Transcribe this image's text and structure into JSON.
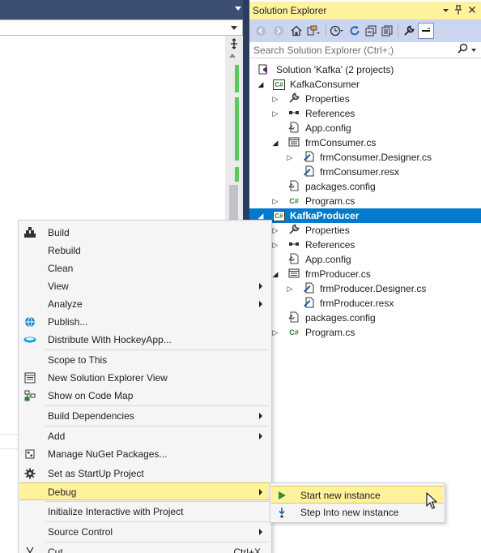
{
  "solution_explorer": {
    "title": "Solution Explorer",
    "search_placeholder": "Search Solution Explorer (Ctrl+;)",
    "toolbar_icons": [
      "back-icon",
      "forward-icon",
      "home-icon",
      "switch-views-icon",
      "history-icon",
      "refresh-icon",
      "collapse-all-icon",
      "show-all-files-icon",
      "properties-icon",
      "preview-icon"
    ],
    "tree": [
      {
        "label": "Solution 'Kafka' (2 projects)",
        "icon": "solution-icon",
        "level": 0,
        "expander": ""
      },
      {
        "label": "KafkaConsumer",
        "icon": "csharp-project-icon",
        "level": 1,
        "expander": "expanded"
      },
      {
        "label": "Properties",
        "icon": "wrench-icon",
        "level": 2,
        "expander": "collapsed"
      },
      {
        "label": "References",
        "icon": "references-icon",
        "level": 2,
        "expander": "collapsed"
      },
      {
        "label": "App.config",
        "icon": "config-file-icon",
        "level": 2,
        "expander": ""
      },
      {
        "label": "frmConsumer.cs",
        "icon": "form-icon",
        "level": 2,
        "expander": "expanded"
      },
      {
        "label": "frmConsumer.Designer.cs",
        "icon": "designer-file-icon",
        "level": 3,
        "expander": "collapsed"
      },
      {
        "label": "frmConsumer.resx",
        "icon": "resx-file-icon",
        "level": 3,
        "expander": ""
      },
      {
        "label": "packages.config",
        "icon": "config-file-icon",
        "level": 2,
        "expander": ""
      },
      {
        "label": "Program.cs",
        "icon": "csharp-file-icon",
        "level": 2,
        "expander": "collapsed"
      },
      {
        "label": "KafkaProducer",
        "icon": "csharp-project-icon",
        "level": 1,
        "expander": "expanded",
        "selected": true
      },
      {
        "label": "Properties",
        "icon": "wrench-icon",
        "level": 2,
        "expander": "collapsed"
      },
      {
        "label": "References",
        "icon": "references-icon",
        "level": 2,
        "expander": "collapsed"
      },
      {
        "label": "App.config",
        "icon": "config-file-icon",
        "level": 2,
        "expander": ""
      },
      {
        "label": "frmProducer.cs",
        "icon": "form-icon",
        "level": 2,
        "expander": "expanded"
      },
      {
        "label": "frmProducer.Designer.cs",
        "icon": "designer-file-icon",
        "level": 3,
        "expander": "collapsed"
      },
      {
        "label": "frmProducer.resx",
        "icon": "resx-file-icon",
        "level": 3,
        "expander": ""
      },
      {
        "label": "packages.config",
        "icon": "config-file-icon",
        "level": 2,
        "expander": ""
      },
      {
        "label": "Program.cs",
        "icon": "csharp-file-icon",
        "level": 2,
        "expander": "collapsed"
      }
    ]
  },
  "context_menu": {
    "items": [
      {
        "label": "Build",
        "icon": "build-icon",
        "submenu": false
      },
      {
        "label": "Rebuild",
        "icon": "",
        "submenu": false
      },
      {
        "label": "Clean",
        "icon": "",
        "submenu": false
      },
      {
        "label": "View",
        "icon": "",
        "submenu": true
      },
      {
        "label": "Analyze",
        "icon": "",
        "submenu": true
      },
      {
        "label": "Publish...",
        "icon": "globe-icon",
        "submenu": false
      },
      {
        "label": "Distribute With HockeyApp...",
        "icon": "hockeyapp-icon",
        "submenu": false,
        "separator_after": true
      },
      {
        "label": "Scope to This",
        "icon": "",
        "submenu": false
      },
      {
        "label": "New Solution Explorer View",
        "icon": "new-view-icon",
        "submenu": false
      },
      {
        "label": "Show on Code Map",
        "icon": "code-map-icon",
        "submenu": false,
        "separator_after": true
      },
      {
        "label": "Build Dependencies",
        "icon": "",
        "submenu": true,
        "separator_after": true
      },
      {
        "label": "Add",
        "icon": "",
        "submenu": true
      },
      {
        "label": "Manage NuGet Packages...",
        "icon": "nuget-icon",
        "submenu": false
      },
      {
        "label": "Set as StartUp Project",
        "icon": "gear-icon",
        "submenu": false
      },
      {
        "label": "Debug",
        "icon": "",
        "submenu": true,
        "highlighted": true,
        "separator_after": true
      },
      {
        "label": "Initialize Interactive with Project",
        "icon": "",
        "submenu": false,
        "separator_after": true
      },
      {
        "label": "Source Control",
        "icon": "",
        "submenu": true,
        "separator_after": true
      },
      {
        "label": "Cut",
        "icon": "scissors-icon",
        "submenu": false,
        "shortcut": "Ctrl+X"
      }
    ]
  },
  "debug_submenu": {
    "items": [
      {
        "label": "Start new instance",
        "icon": "play-icon",
        "highlighted": true
      },
      {
        "label": "Step Into new instance",
        "icon": "step-into-icon",
        "highlighted": false
      }
    ]
  },
  "colors": {
    "selection": "#007acc",
    "highlight": "#fff29d",
    "title_bar": "#fff29d",
    "toolbar": "#ccd5f0",
    "change_marker": "#5ec85e"
  }
}
